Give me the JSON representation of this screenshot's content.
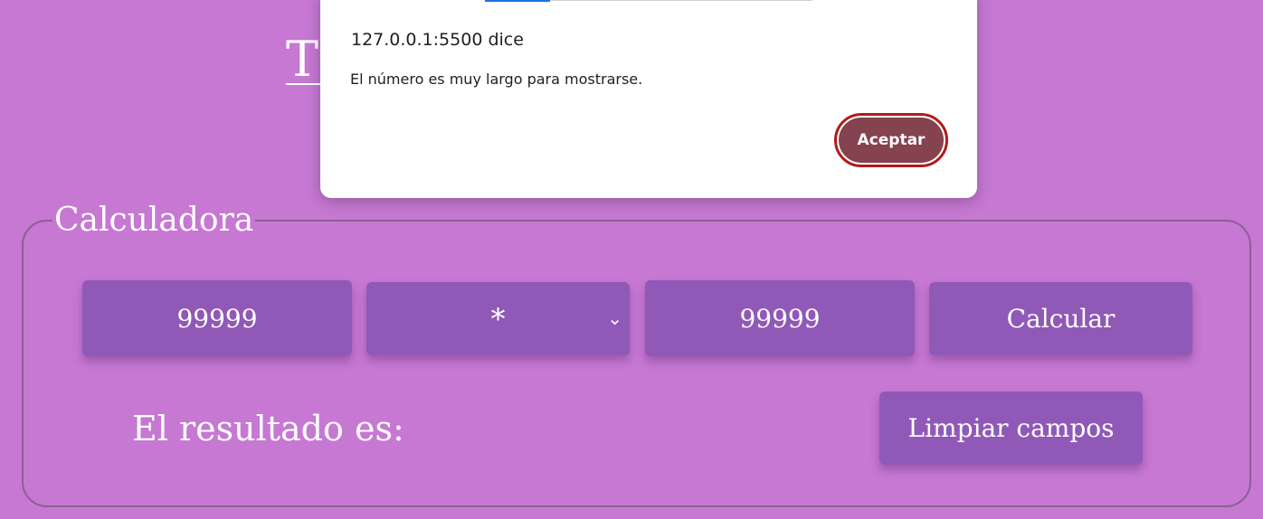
{
  "page": {
    "title": "Trabajo Calculadora Simple"
  },
  "calculator": {
    "legend": "Calculadora",
    "number1_value": "99999",
    "operator_value": "*",
    "number2_value": "99999",
    "calculate_label": "Calcular",
    "result_label": "El resultado es:",
    "clear_label": "Limpiar campos"
  },
  "dialog": {
    "origin": "127.0.0.1:5500 dice",
    "message": "El número es muy largo para mostrarse.",
    "ok_label": "Aceptar"
  },
  "colors": {
    "background": "#c678d3",
    "field": "#9059b7",
    "dialog_button": "#85424f",
    "focus_ring": "#b21a1a"
  }
}
